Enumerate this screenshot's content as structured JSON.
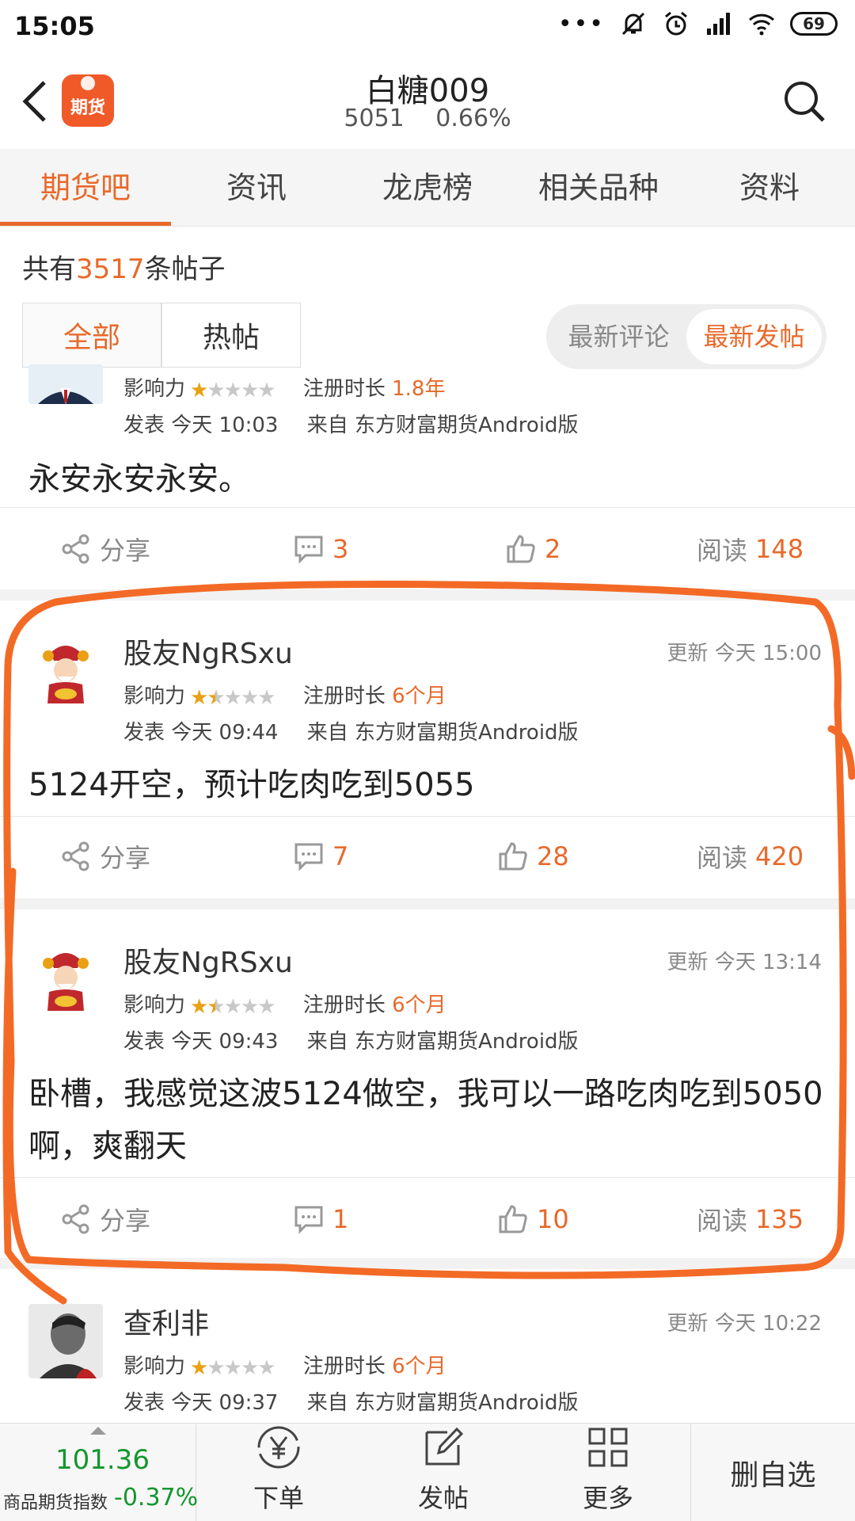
{
  "status_bar": {
    "time": "15:05",
    "battery": "69"
  },
  "header": {
    "logo_text": "期货",
    "title": "白糖009",
    "price": "5051",
    "change": "0.66%"
  },
  "tabs": [
    "期货吧",
    "资讯",
    "龙虎榜",
    "相关品种",
    "资料"
  ],
  "summary": {
    "prefix": "共有",
    "count": "3517",
    "suffix": "条帖子"
  },
  "filters": [
    "全部",
    "热帖"
  ],
  "sort": [
    "最新评论",
    "最新发帖"
  ],
  "labels": {
    "influence": "影响力",
    "reg": "注册时长",
    "posted": "发表",
    "from": "来自",
    "share": "分享",
    "read": "阅读",
    "updated": "更新"
  },
  "posts": [
    {
      "influence_stars": 1,
      "reg_time": "1.8年",
      "posted": "今天 10:03",
      "source": "东方财富期货Android版",
      "content": "永安永安永安。",
      "comments": "3",
      "likes": "2",
      "reads": "148"
    },
    {
      "author": "股友NgRSxu",
      "updated": "今天 15:00",
      "influence_stars": 1.5,
      "reg_time": "6个月",
      "posted": "今天 09:44",
      "source": "东方财富期货Android版",
      "content": "5124开空，预计吃肉吃到5055",
      "comments": "7",
      "likes": "28",
      "reads": "420"
    },
    {
      "author": "股友NgRSxu",
      "updated": "今天 13:14",
      "influence_stars": 1.5,
      "reg_time": "6个月",
      "posted": "今天 09:43",
      "source": "东方财富期货Android版",
      "content": "卧槽，我感觉这波5124做空，我可以一路吃肉吃到5050啊，爽翻天",
      "comments": "1",
      "likes": "10",
      "reads": "135"
    },
    {
      "author": "查利非",
      "updated": "今天 10:22",
      "influence_stars": 1,
      "reg_time": "6个月",
      "posted": "今天 09:37",
      "source": "东方财富期货Android版"
    }
  ],
  "bottom_bar": {
    "index_value": "101.36",
    "index_label": "商品期货指数",
    "index_change": "-0.37%",
    "buttons": [
      "下单",
      "发帖",
      "更多"
    ],
    "unfollow": "删自选"
  },
  "colors": {
    "accent": "#e8692a",
    "down": "#14962e",
    "star": "#e9a012"
  }
}
